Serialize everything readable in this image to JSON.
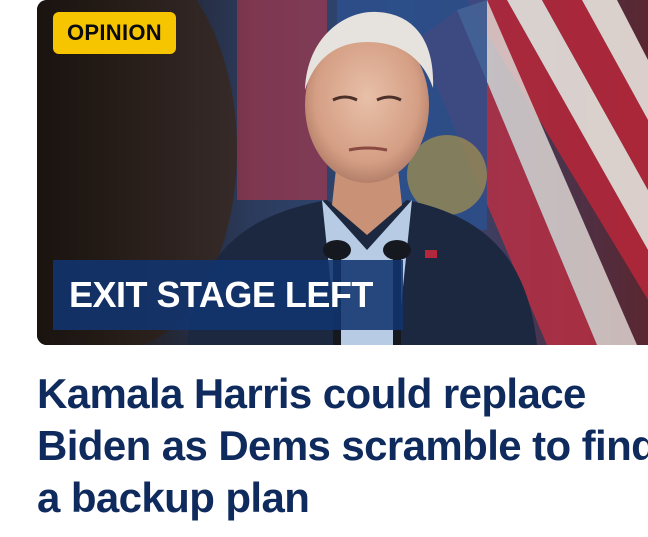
{
  "article": {
    "badge": "OPINION",
    "kicker": "EXIT STAGE LEFT",
    "headline_lines": [
      "Kamala Harris could replace",
      "Biden as Dems scramble to find",
      "a backup plan"
    ],
    "image": {
      "subject": "photo-of-speaker-at-podium-with-flags"
    }
  },
  "colors": {
    "badge_bg": "#f7c500",
    "kicker_bg": "#113470",
    "headline": "#0f2a5c"
  }
}
